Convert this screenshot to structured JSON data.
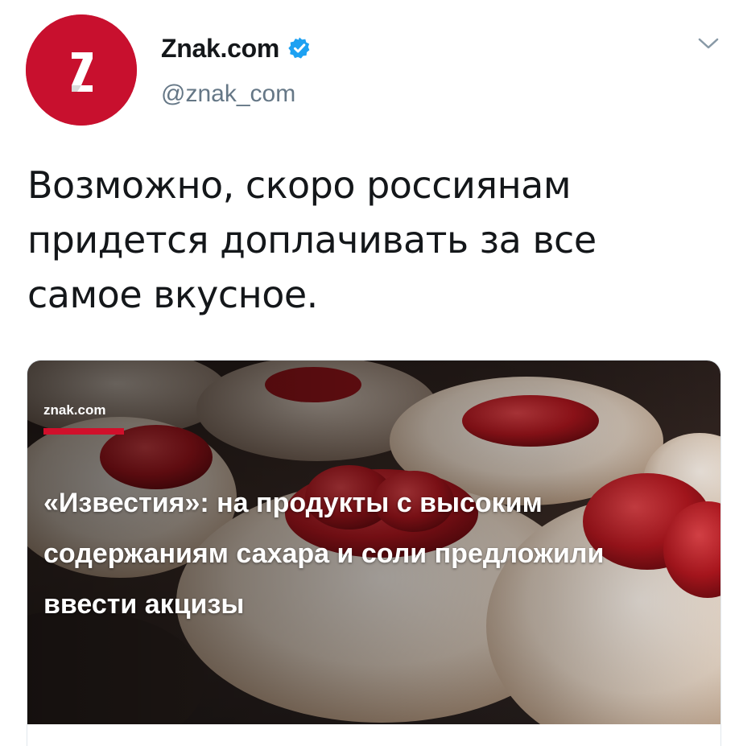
{
  "tweet": {
    "display_name": "Znak.com",
    "handle": "@znak_com",
    "avatar_letter": "Z",
    "verified": true,
    "text": "Возможно, скоро россиянам придется доплачивать за все самое вкусное."
  },
  "card": {
    "brand": "znak.com",
    "title": "«Известия»: на продукты с высоким содержаниям сахара и соли предложили ввести акцизы",
    "image_subject": "pastries-with-strawberries"
  },
  "icons": {
    "verified": "verified-check-icon",
    "menu": "chevron-down-icon"
  },
  "colors": {
    "brand_red": "#c8102e",
    "verified_blue": "#1da1f2",
    "handle_gray": "#657786",
    "text": "#14171a"
  }
}
